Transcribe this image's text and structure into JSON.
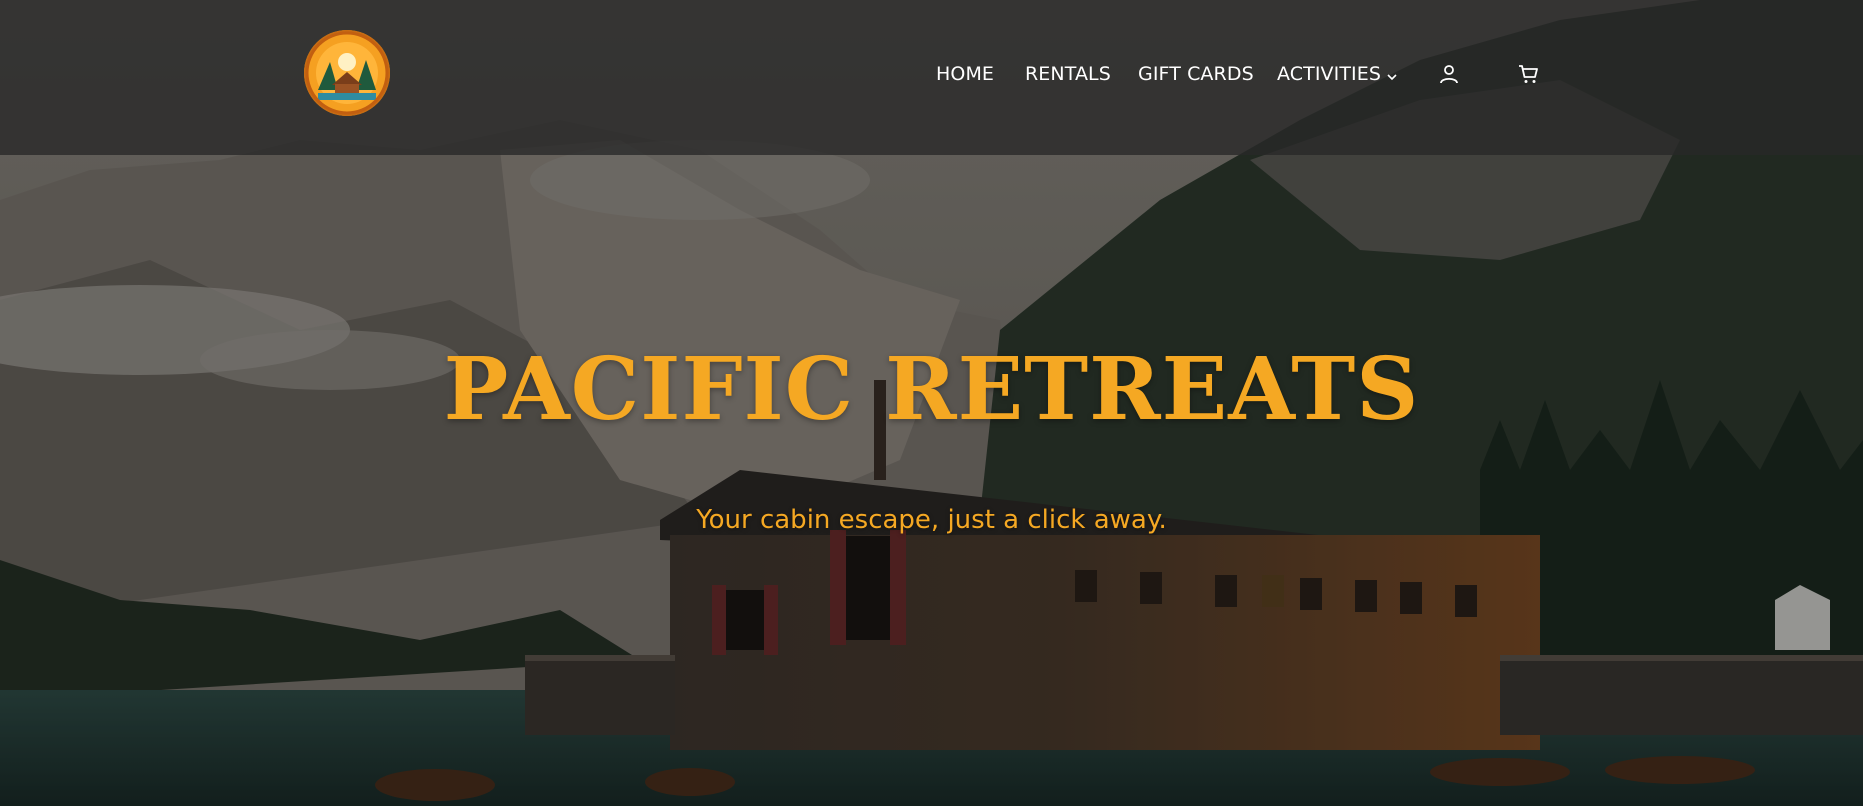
{
  "brand": {
    "logo_text_top": "PACIFIC",
    "logo_text_bottom": "RETREATS",
    "logo_icon": "cabin-sunset-logo"
  },
  "nav": {
    "items": [
      {
        "label": "HOME"
      },
      {
        "label": "RENTALS"
      },
      {
        "label": "GIFT CARDS"
      },
      {
        "label": "ACTIVITIES"
      }
    ],
    "account_icon": "user-icon",
    "cart_icon": "cart-icon"
  },
  "hero": {
    "title": "PACIFIC RETREATS",
    "subtitle": "Your cabin escape, just a click away."
  },
  "colors": {
    "accent": "#f5a823",
    "header_bg": "#282828",
    "nav_text": "#ffffff"
  }
}
